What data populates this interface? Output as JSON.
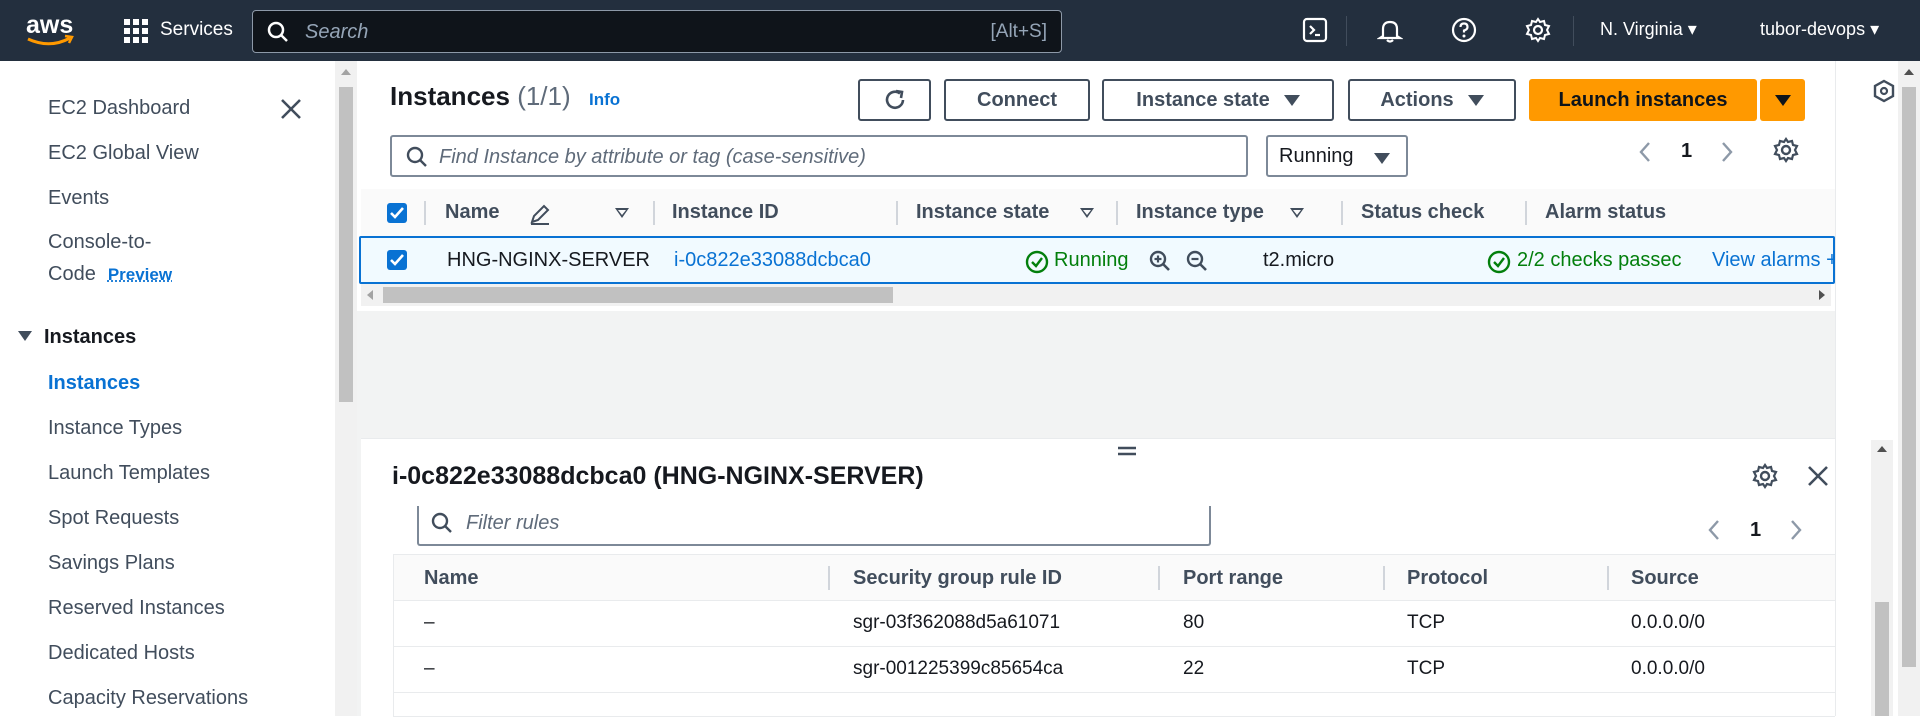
{
  "topnav": {
    "logo_text": "aws",
    "services_label": "Services",
    "search_placeholder": "Search",
    "search_shortcut": "[Alt+S]",
    "region": "N. Virginia",
    "account": "tubor-devops",
    "icons": [
      "cloudshell-icon",
      "bell-icon",
      "help-icon",
      "gear-icon"
    ]
  },
  "sidebar": {
    "items_top": [
      "EC2 Dashboard",
      "EC2 Global View",
      "Events"
    ],
    "console_to_code": {
      "line1": "Console-to-",
      "line2": "Code",
      "badge": "Preview"
    },
    "section": "Instances",
    "items": [
      "Instances",
      "Instance Types",
      "Launch Templates",
      "Spot Requests",
      "Savings Plans",
      "Reserved Instances",
      "Dedicated Hosts",
      "Capacity Reservations"
    ],
    "active": "Instances"
  },
  "instances_panel": {
    "title": "Instances",
    "count": "(1/1)",
    "info": "Info",
    "buttons": {
      "connect": "Connect",
      "instance_state": "Instance state",
      "actions": "Actions",
      "launch": "Launch instances"
    },
    "search_placeholder": "Find Instance by attribute or tag (case-sensitive)",
    "state_filter": "Running",
    "page": "1",
    "columns": [
      "Name",
      "Instance ID",
      "Instance state",
      "Instance type",
      "Status check",
      "Alarm status"
    ],
    "row": {
      "name": "HNG-NGINX-SERVER",
      "instance_id": "i-0c822e33088dcbca0",
      "state": "Running",
      "type": "t2.micro",
      "status_check": "2/2 checks passec",
      "alarm": "View alarms +"
    }
  },
  "details_panel": {
    "title": "i-0c822e33088dcbca0 (HNG-NGINX-SERVER)",
    "filter_placeholder": "Filter rules",
    "page": "1",
    "columns": [
      "Name",
      "Security group rule ID",
      "Port range",
      "Protocol",
      "Source"
    ],
    "rows": [
      {
        "name": "–",
        "rule_id": "sgr-03f362088d5a61071",
        "port": "80",
        "protocol": "TCP",
        "source": "0.0.0.0/0"
      },
      {
        "name": "–",
        "rule_id": "sgr-001225399c85654ca",
        "port": "22",
        "protocol": "TCP",
        "source": "0.0.0.0/0"
      }
    ]
  },
  "colors": {
    "nav_bg": "#232f3e",
    "accent": "#ff9900",
    "link": "#0972d3",
    "success": "#037f0c"
  }
}
